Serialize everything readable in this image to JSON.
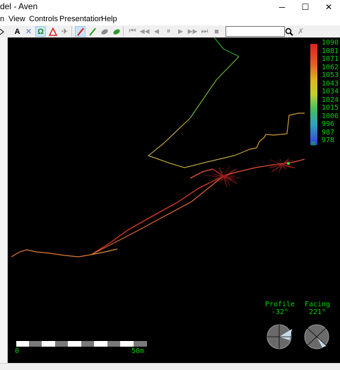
{
  "window": {
    "title": "del - Aven",
    "minimize_icon": "minimize-icon",
    "maximize_icon": "maximize-icon",
    "close_icon": "close-icon"
  },
  "menu": {
    "items": [
      "View",
      "Controls",
      "Presentation",
      "Help"
    ]
  },
  "toolbar": {
    "search_value": "",
    "buttons": [
      {
        "icon": "text-label-icon",
        "glyph": "A"
      },
      {
        "icon": "crosses-icon",
        "glyph": "✕"
      },
      {
        "icon": "entrances-icon",
        "glyph": "Ω"
      },
      {
        "icon": "fixed-points-icon",
        "glyph": "⚠"
      },
      {
        "icon": "exported-points-icon",
        "glyph": "✈"
      },
      {
        "icon": "centreline-icon",
        "glyph": "/"
      },
      {
        "icon": "splays-icon",
        "glyph": "/"
      },
      {
        "icon": "walls-icon",
        "glyph": "⬬"
      },
      {
        "icon": "passage-icon",
        "glyph": "⬬"
      },
      {
        "icon": "rewind-start-icon",
        "glyph": "⏮"
      },
      {
        "icon": "rewind-fast-icon",
        "glyph": "◀◀"
      },
      {
        "icon": "rewind-icon",
        "glyph": "◀"
      },
      {
        "icon": "pause-icon",
        "glyph": "⏸"
      },
      {
        "icon": "play-icon",
        "glyph": "▶"
      },
      {
        "icon": "play-fast-icon",
        "glyph": "▶▶"
      },
      {
        "icon": "play-end-icon",
        "glyph": "⏭"
      },
      {
        "icon": "stop-icon",
        "glyph": "■"
      },
      {
        "icon": "find-icon",
        "glyph": "🔍"
      },
      {
        "icon": "hide-found-icon",
        "glyph": "✗"
      }
    ]
  },
  "legend": {
    "values": [
      "1090",
      "1081",
      "1071",
      "1062",
      "1053",
      "1043",
      "1034",
      "1024",
      "1015",
      "1006",
      "996",
      "987",
      "978"
    ],
    "unit": "m"
  },
  "scalebar": {
    "start": "0",
    "end": "50m"
  },
  "indicators": {
    "profile": {
      "label": "Profile",
      "value": "-32°"
    },
    "facing": {
      "label": "Facing",
      "value": "221°"
    }
  },
  "colors": {
    "viewport_bg": "#000000",
    "legend_text": "#00d000",
    "leg_high": "#e02020",
    "leg_low": "#3050e0"
  }
}
